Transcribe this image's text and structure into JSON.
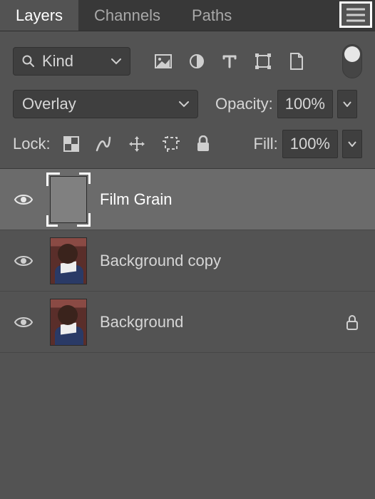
{
  "tabs": {
    "layers": "Layers",
    "channels": "Channels",
    "paths": "Paths"
  },
  "filter": {
    "kind_label": "Kind"
  },
  "blend": {
    "mode": "Overlay",
    "opacity_label": "Opacity:",
    "opacity_value": "100%"
  },
  "lock": {
    "label": "Lock:",
    "fill_label": "Fill:",
    "fill_value": "100%"
  },
  "layers": [
    {
      "name": "Film Grain",
      "selected": true,
      "thumb": "grain",
      "locked": false
    },
    {
      "name": "Background copy",
      "selected": false,
      "thumb": "photo",
      "locked": false
    },
    {
      "name": "Background",
      "selected": false,
      "thumb": "photo",
      "locked": true
    }
  ]
}
